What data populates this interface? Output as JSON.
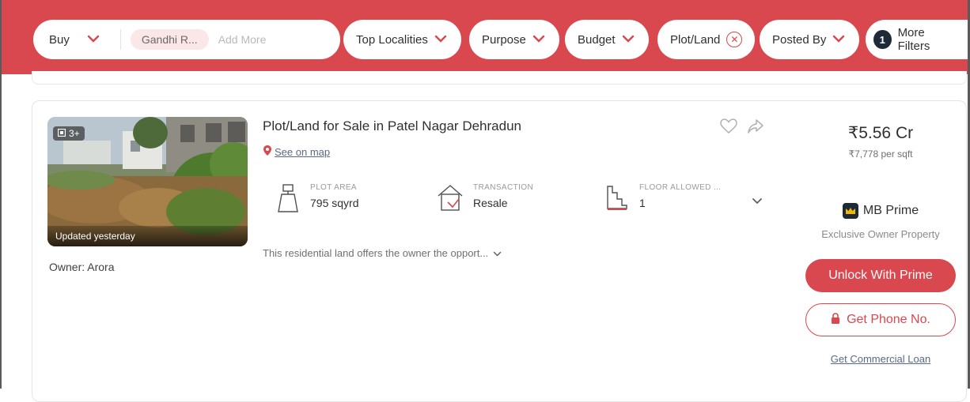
{
  "filter_bar": {
    "buy_label": "Buy",
    "location_chip": "Gandhi R...",
    "add_more_placeholder": "Add More",
    "filters": [
      {
        "label": "Top Localities"
      },
      {
        "label": "Purpose"
      },
      {
        "label": "Budget"
      },
      {
        "label": "Plot/Land"
      },
      {
        "label": "Posted By"
      }
    ],
    "more_filters_count": "1",
    "more_filters_label": "More Filters"
  },
  "listing": {
    "image_count": "3+",
    "updated_label": "Updated yesterday",
    "owner": "Owner: Arora",
    "title": "Plot/Land for Sale in Patel Nagar Dehradun",
    "map_link": "See on map",
    "specs": [
      {
        "label": "PLOT AREA",
        "value": "795 sqyrd",
        "icon": "plot-area-icon"
      },
      {
        "label": "TRANSACTION",
        "value": "Resale",
        "icon": "transaction-icon"
      },
      {
        "label": "FLOOR ALLOWED ...",
        "value": "1",
        "icon": "floors-icon"
      }
    ],
    "description": "This residential land offers the owner the opport...",
    "price": "₹5.56 Cr",
    "price_per_sqft": "₹7,778 per sqft",
    "prime_label": "MB Prime",
    "exclusive_label": "Exclusive Owner Property",
    "unlock_button": "Unlock With Prime",
    "phone_button": "Get Phone No.",
    "loan_link": "Get Commercial Loan"
  },
  "colors": {
    "accent": "#d9474f",
    "dark": "#1f2a38"
  }
}
